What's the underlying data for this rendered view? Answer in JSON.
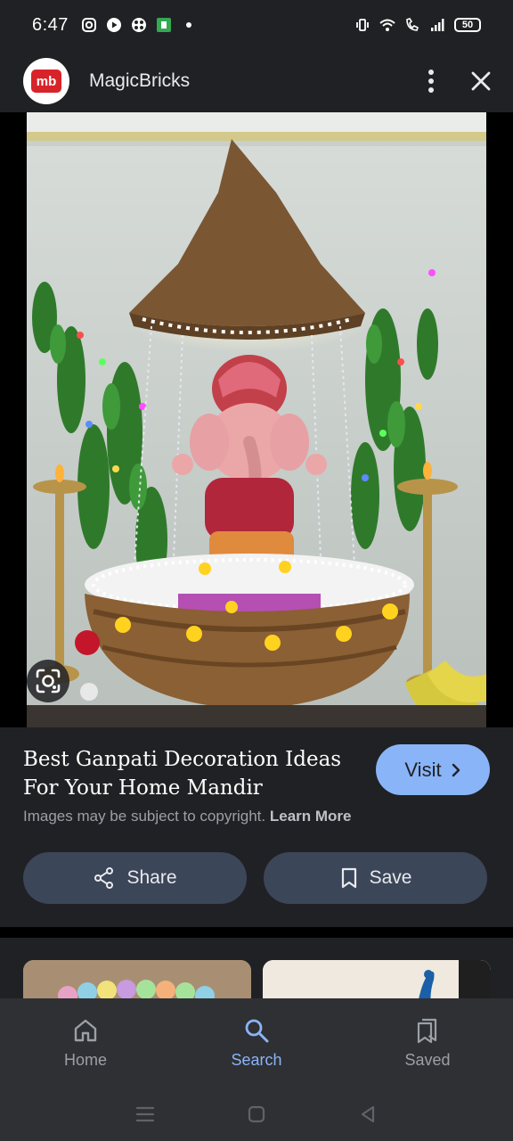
{
  "status_bar": {
    "time": "6:47",
    "battery": "50",
    "left_icons": [
      "instagram-icon",
      "youtube-icon",
      "game-icon",
      "app-icon",
      "dot-icon"
    ],
    "right_icons": [
      "vibrate-icon",
      "wifi-icon",
      "wifi-call-icon",
      "signal-icon",
      "battery-icon"
    ]
  },
  "header": {
    "logo_text": "mb",
    "site_name": "MagicBricks"
  },
  "result": {
    "title": "Best Ganpati Decoration Ideas For Your Home Mandir",
    "visit_label": "Visit",
    "copyright_text": "Images may be subject to copyright.",
    "learn_more": "Learn More",
    "share_label": "Share",
    "save_label": "Save"
  },
  "bottom_nav": {
    "items": [
      {
        "label": "Home",
        "icon": "home-icon",
        "active": false
      },
      {
        "label": "Search",
        "icon": "search-icon",
        "active": true
      },
      {
        "label": "Saved",
        "icon": "saved-icon",
        "active": false
      }
    ]
  },
  "colors": {
    "background": "#202124",
    "accent": "#8ab4f8",
    "button_bg": "#3c4659",
    "brand_red": "#d8232a"
  }
}
